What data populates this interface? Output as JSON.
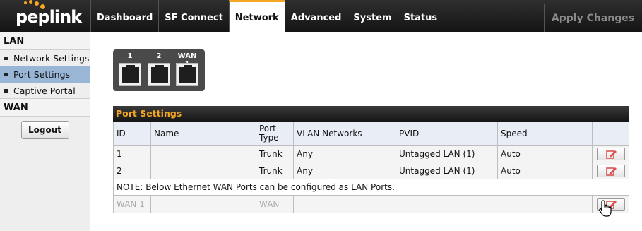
{
  "app": {
    "logo_text": "peplink",
    "brand_color": "#f5a623"
  },
  "nav": {
    "tabs": [
      "Dashboard",
      "SF Connect",
      "Network",
      "Advanced",
      "System",
      "Status"
    ],
    "active": "Network",
    "apply_label": "Apply Changes"
  },
  "sidebar": {
    "lan_heading": "LAN",
    "items": [
      "Network Settings",
      "Port Settings",
      "Captive Portal"
    ],
    "active_item": "Port Settings",
    "wan_heading": "WAN",
    "logout_label": "Logout"
  },
  "ports": [
    {
      "label": "1",
      "icon": "ethernet-port-icon"
    },
    {
      "label": "2",
      "icon": "ethernet-port-icon"
    },
    {
      "label": "WAN 1",
      "icon": "ethernet-port-icon"
    }
  ],
  "port_settings": {
    "title": "Port Settings",
    "columns": [
      "ID",
      "Name",
      "Port\nType",
      "VLAN Networks",
      "PVID",
      "Speed",
      ""
    ],
    "rows": [
      {
        "id": "1",
        "name": "",
        "port_type": "Trunk",
        "vlan": "Any",
        "pvid": "Untagged LAN (1)",
        "speed": "Auto"
      },
      {
        "id": "2",
        "name": "",
        "port_type": "Trunk",
        "vlan": "Any",
        "pvid": "Untagged LAN (1)",
        "speed": "Auto"
      }
    ],
    "note": "NOTE: Below Ethernet WAN Ports can be configured as LAN Ports.",
    "wan_row": {
      "id": "WAN 1",
      "name": "",
      "port_type": "WAN"
    }
  },
  "icons": {
    "edit": "edit-pencil-icon",
    "cursor": "hand-pointer-icon"
  }
}
